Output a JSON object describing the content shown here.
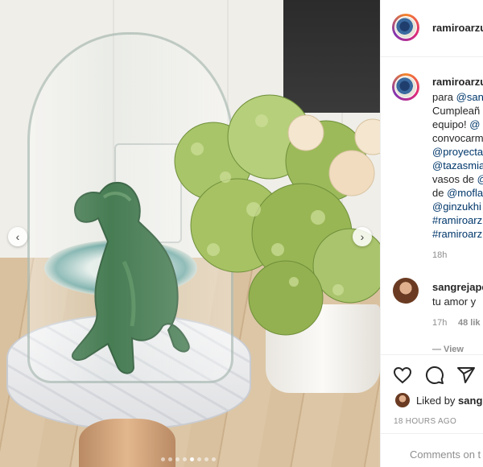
{
  "post": {
    "username": "ramiroarzu",
    "carousel": {
      "active_index": 4,
      "count": 8
    }
  },
  "caption": {
    "username": "ramiroarzu",
    "lines": [
      {
        "text": "para ",
        "mention": "@san"
      },
      {
        "text": "Cumpleañ",
        "mention": ""
      },
      {
        "text": "equipo! ",
        "mention": "@"
      },
      {
        "text": "convocarm",
        "mention": ""
      },
      {
        "text": "",
        "mention": "@proyecta"
      },
      {
        "text": "",
        "mention": "@tazasmia"
      },
      {
        "text": "vasos de ",
        "mention": "@"
      },
      {
        "text": "de ",
        "mention": "@mofla"
      },
      {
        "text": "",
        "mention": "@ginzukhi"
      },
      {
        "text": "",
        "mention": "#ramiroarz"
      },
      {
        "text": "",
        "mention": "#ramiroarzu"
      }
    ],
    "time": "18h"
  },
  "comment": {
    "username": "sangrejape",
    "text": "tu amor y",
    "time": "17h",
    "likes": "48 lik",
    "view_replies": "— View"
  },
  "liked_by": {
    "prefix": "Liked by ",
    "name": "sang"
  },
  "timestamp": "18 HOURS AGO",
  "comments_placeholder": "Comments on t"
}
